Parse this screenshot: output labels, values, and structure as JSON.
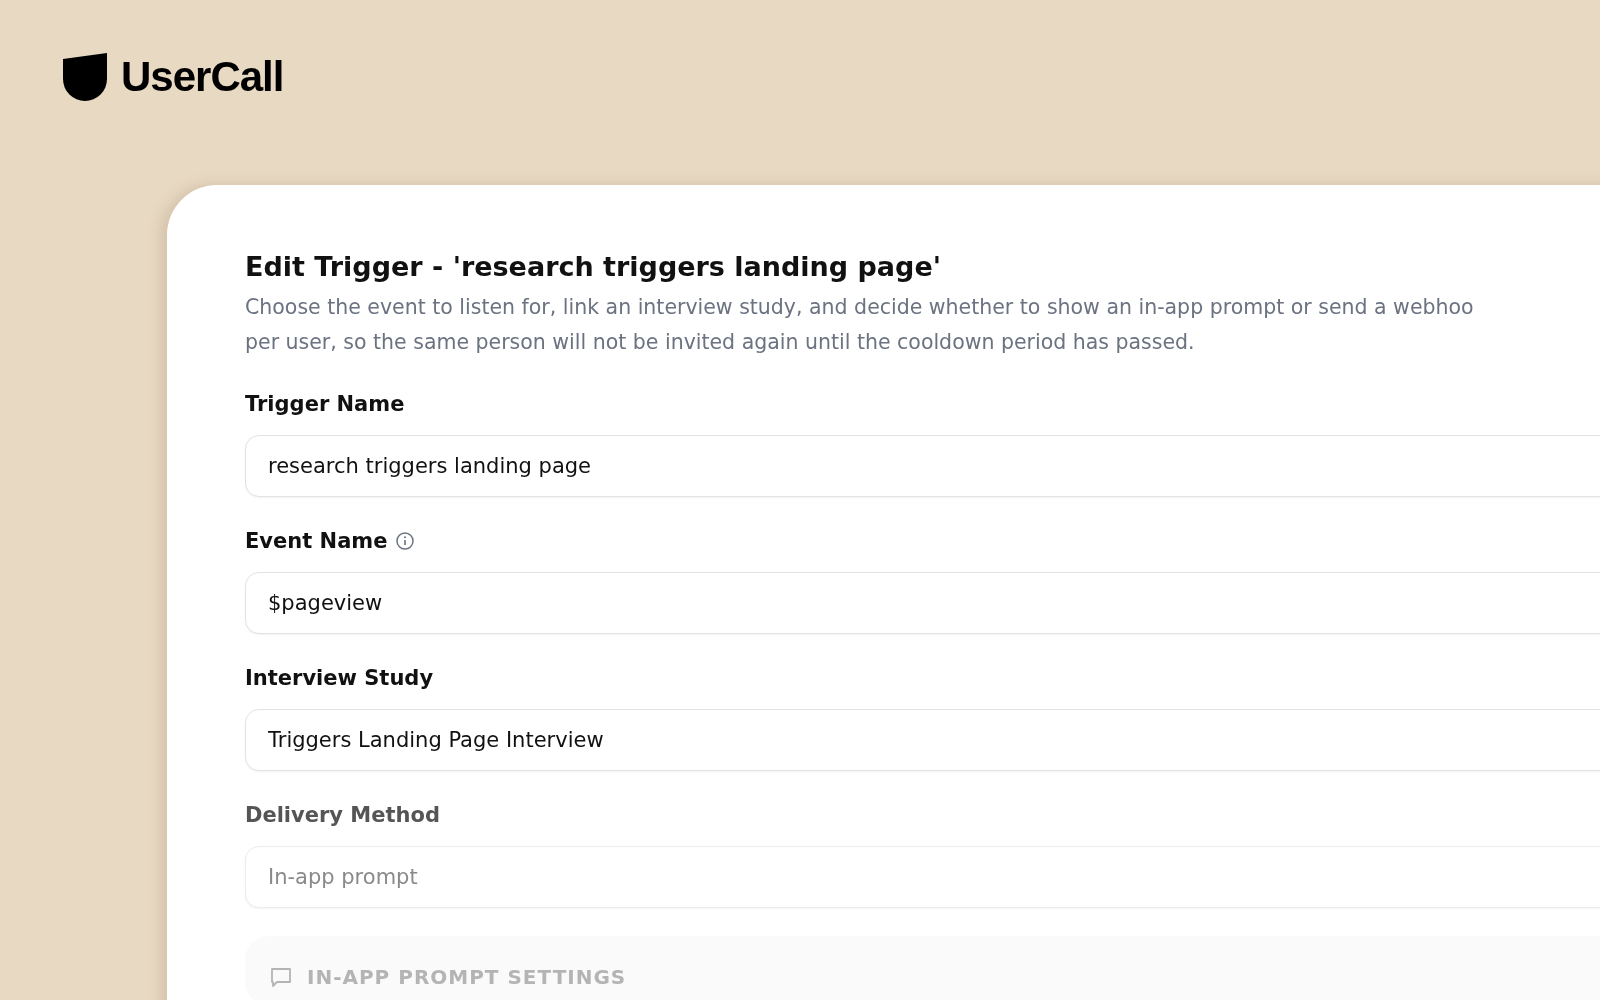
{
  "brand": {
    "name": "UserCall"
  },
  "dialog": {
    "title": "Edit Trigger - 'research triggers landing page'",
    "description_lines": [
      "Choose the event to listen for, link an interview study, and decide whether to show an in-app prompt or send a webhoo",
      "per user, so the same person will not be invited again until the cooldown period has passed."
    ],
    "fields": [
      {
        "label": "Trigger Name",
        "value": "research triggers landing page",
        "info": false,
        "disabled": false
      },
      {
        "label": "Event Name",
        "value": "$pageview",
        "info": true,
        "disabled": false
      },
      {
        "label": "Interview Study",
        "value": "Triggers Landing Page Interview",
        "info": false,
        "disabled": false
      },
      {
        "label": "Delivery Method",
        "value": "In-app prompt",
        "info": false,
        "disabled": true
      }
    ],
    "section": {
      "title": "IN-APP PROMPT SETTINGS",
      "disabled": true
    }
  }
}
